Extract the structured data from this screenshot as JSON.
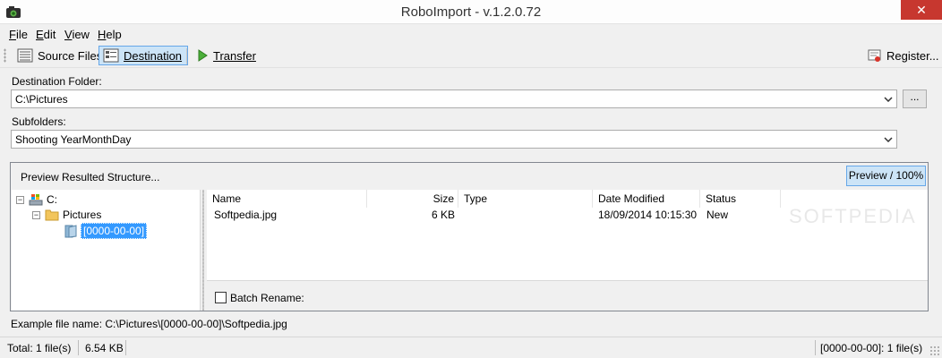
{
  "window": {
    "title": "RoboImport - v.1.2.0.72",
    "close_glyph": "✕"
  },
  "menu": [
    {
      "accel": "F",
      "rest": "ile"
    },
    {
      "accel": "E",
      "rest": "dit"
    },
    {
      "accel": "V",
      "rest": "iew"
    },
    {
      "accel": "H",
      "rest": "elp"
    }
  ],
  "toolbar": {
    "source_files": "Source Files",
    "destination": "Destination",
    "transfer": "Transfer",
    "register": "Register..."
  },
  "destination": {
    "label": "Destination Folder:",
    "value": "C:\\Pictures",
    "browse": "...",
    "subfolders_label": "Subfolders:",
    "subfolders_value": "Shooting YearMonthDay"
  },
  "preview": {
    "title": "Preview Resulted Structure...",
    "button": "Preview / 100%",
    "tree": {
      "root": "C:",
      "folder": "Pictures",
      "selected": "[0000-00-00]"
    },
    "columns": [
      "Name",
      "Size",
      "Type",
      "Date Modified",
      "Status"
    ],
    "rows": [
      {
        "name": "Softpedia.jpg",
        "size": "6 KB",
        "type": "",
        "date": "18/09/2014 10:15:30",
        "status": "New"
      }
    ],
    "watermark": "SOFTPEDIA",
    "batch_rename": "Batch Rename:"
  },
  "example": {
    "label": "Example file name:",
    "value": "C:\\Pictures\\[0000-00-00]\\Softpedia.jpg"
  },
  "status": {
    "total": "Total: 1 file(s)",
    "size": "6.54 KB",
    "folder_count": "[0000-00-00]: 1 file(s)"
  }
}
